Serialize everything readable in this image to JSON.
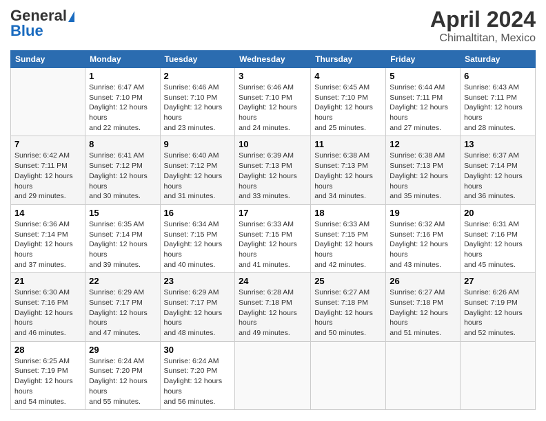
{
  "header": {
    "logo_general": "General",
    "logo_blue": "Blue",
    "month": "April 2024",
    "location": "Chimaltitan, Mexico"
  },
  "columns": [
    "Sunday",
    "Monday",
    "Tuesday",
    "Wednesday",
    "Thursday",
    "Friday",
    "Saturday"
  ],
  "weeks": [
    [
      {
        "day": "",
        "sunrise": "",
        "sunset": "",
        "daylight": ""
      },
      {
        "day": "1",
        "sunrise": "Sunrise: 6:47 AM",
        "sunset": "Sunset: 7:10 PM",
        "daylight": "Daylight: 12 hours and 22 minutes."
      },
      {
        "day": "2",
        "sunrise": "Sunrise: 6:46 AM",
        "sunset": "Sunset: 7:10 PM",
        "daylight": "Daylight: 12 hours and 23 minutes."
      },
      {
        "day": "3",
        "sunrise": "Sunrise: 6:46 AM",
        "sunset": "Sunset: 7:10 PM",
        "daylight": "Daylight: 12 hours and 24 minutes."
      },
      {
        "day": "4",
        "sunrise": "Sunrise: 6:45 AM",
        "sunset": "Sunset: 7:10 PM",
        "daylight": "Daylight: 12 hours and 25 minutes."
      },
      {
        "day": "5",
        "sunrise": "Sunrise: 6:44 AM",
        "sunset": "Sunset: 7:11 PM",
        "daylight": "Daylight: 12 hours and 27 minutes."
      },
      {
        "day": "6",
        "sunrise": "Sunrise: 6:43 AM",
        "sunset": "Sunset: 7:11 PM",
        "daylight": "Daylight: 12 hours and 28 minutes."
      }
    ],
    [
      {
        "day": "7",
        "sunrise": "Sunrise: 6:42 AM",
        "sunset": "Sunset: 7:11 PM",
        "daylight": "Daylight: 12 hours and 29 minutes."
      },
      {
        "day": "8",
        "sunrise": "Sunrise: 6:41 AM",
        "sunset": "Sunset: 7:12 PM",
        "daylight": "Daylight: 12 hours and 30 minutes."
      },
      {
        "day": "9",
        "sunrise": "Sunrise: 6:40 AM",
        "sunset": "Sunset: 7:12 PM",
        "daylight": "Daylight: 12 hours and 31 minutes."
      },
      {
        "day": "10",
        "sunrise": "Sunrise: 6:39 AM",
        "sunset": "Sunset: 7:13 PM",
        "daylight": "Daylight: 12 hours and 33 minutes."
      },
      {
        "day": "11",
        "sunrise": "Sunrise: 6:38 AM",
        "sunset": "Sunset: 7:13 PM",
        "daylight": "Daylight: 12 hours and 34 minutes."
      },
      {
        "day": "12",
        "sunrise": "Sunrise: 6:38 AM",
        "sunset": "Sunset: 7:13 PM",
        "daylight": "Daylight: 12 hours and 35 minutes."
      },
      {
        "day": "13",
        "sunrise": "Sunrise: 6:37 AM",
        "sunset": "Sunset: 7:14 PM",
        "daylight": "Daylight: 12 hours and 36 minutes."
      }
    ],
    [
      {
        "day": "14",
        "sunrise": "Sunrise: 6:36 AM",
        "sunset": "Sunset: 7:14 PM",
        "daylight": "Daylight: 12 hours and 37 minutes."
      },
      {
        "day": "15",
        "sunrise": "Sunrise: 6:35 AM",
        "sunset": "Sunset: 7:14 PM",
        "daylight": "Daylight: 12 hours and 39 minutes."
      },
      {
        "day": "16",
        "sunrise": "Sunrise: 6:34 AM",
        "sunset": "Sunset: 7:15 PM",
        "daylight": "Daylight: 12 hours and 40 minutes."
      },
      {
        "day": "17",
        "sunrise": "Sunrise: 6:33 AM",
        "sunset": "Sunset: 7:15 PM",
        "daylight": "Daylight: 12 hours and 41 minutes."
      },
      {
        "day": "18",
        "sunrise": "Sunrise: 6:33 AM",
        "sunset": "Sunset: 7:15 PM",
        "daylight": "Daylight: 12 hours and 42 minutes."
      },
      {
        "day": "19",
        "sunrise": "Sunrise: 6:32 AM",
        "sunset": "Sunset: 7:16 PM",
        "daylight": "Daylight: 12 hours and 43 minutes."
      },
      {
        "day": "20",
        "sunrise": "Sunrise: 6:31 AM",
        "sunset": "Sunset: 7:16 PM",
        "daylight": "Daylight: 12 hours and 45 minutes."
      }
    ],
    [
      {
        "day": "21",
        "sunrise": "Sunrise: 6:30 AM",
        "sunset": "Sunset: 7:16 PM",
        "daylight": "Daylight: 12 hours and 46 minutes."
      },
      {
        "day": "22",
        "sunrise": "Sunrise: 6:29 AM",
        "sunset": "Sunset: 7:17 PM",
        "daylight": "Daylight: 12 hours and 47 minutes."
      },
      {
        "day": "23",
        "sunrise": "Sunrise: 6:29 AM",
        "sunset": "Sunset: 7:17 PM",
        "daylight": "Daylight: 12 hours and 48 minutes."
      },
      {
        "day": "24",
        "sunrise": "Sunrise: 6:28 AM",
        "sunset": "Sunset: 7:18 PM",
        "daylight": "Daylight: 12 hours and 49 minutes."
      },
      {
        "day": "25",
        "sunrise": "Sunrise: 6:27 AM",
        "sunset": "Sunset: 7:18 PM",
        "daylight": "Daylight: 12 hours and 50 minutes."
      },
      {
        "day": "26",
        "sunrise": "Sunrise: 6:27 AM",
        "sunset": "Sunset: 7:18 PM",
        "daylight": "Daylight: 12 hours and 51 minutes."
      },
      {
        "day": "27",
        "sunrise": "Sunrise: 6:26 AM",
        "sunset": "Sunset: 7:19 PM",
        "daylight": "Daylight: 12 hours and 52 minutes."
      }
    ],
    [
      {
        "day": "28",
        "sunrise": "Sunrise: 6:25 AM",
        "sunset": "Sunset: 7:19 PM",
        "daylight": "Daylight: 12 hours and 54 minutes."
      },
      {
        "day": "29",
        "sunrise": "Sunrise: 6:24 AM",
        "sunset": "Sunset: 7:20 PM",
        "daylight": "Daylight: 12 hours and 55 minutes."
      },
      {
        "day": "30",
        "sunrise": "Sunrise: 6:24 AM",
        "sunset": "Sunset: 7:20 PM",
        "daylight": "Daylight: 12 hours and 56 minutes."
      },
      {
        "day": "",
        "sunrise": "",
        "sunset": "",
        "daylight": ""
      },
      {
        "day": "",
        "sunrise": "",
        "sunset": "",
        "daylight": ""
      },
      {
        "day": "",
        "sunrise": "",
        "sunset": "",
        "daylight": ""
      },
      {
        "day": "",
        "sunrise": "",
        "sunset": "",
        "daylight": ""
      }
    ]
  ]
}
